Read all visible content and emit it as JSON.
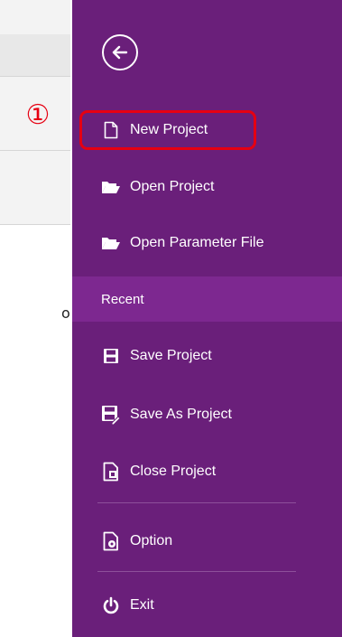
{
  "marker": "①",
  "left_fragment": "o",
  "menu": {
    "back_icon": "back-arrow-icon",
    "items": [
      {
        "label": "New Project",
        "icon": "new-file-icon"
      },
      {
        "label": "Open Project",
        "icon": "open-folder-icon"
      },
      {
        "label": "Open Parameter File",
        "icon": "open-folder-icon"
      }
    ],
    "recent_label": "Recent",
    "recent_items": [
      {
        "label": "Save Project",
        "icon": "save-icon"
      },
      {
        "label": "Save As Project",
        "icon": "save-as-icon"
      },
      {
        "label": "Close Project",
        "icon": "close-project-icon"
      },
      {
        "label": "Option",
        "icon": "option-icon"
      },
      {
        "label": "Exit",
        "icon": "power-icon"
      }
    ]
  },
  "colors": {
    "menu_bg": "#6a1f7a",
    "recent_bg": "#7d2890",
    "highlight": "#e60012"
  }
}
